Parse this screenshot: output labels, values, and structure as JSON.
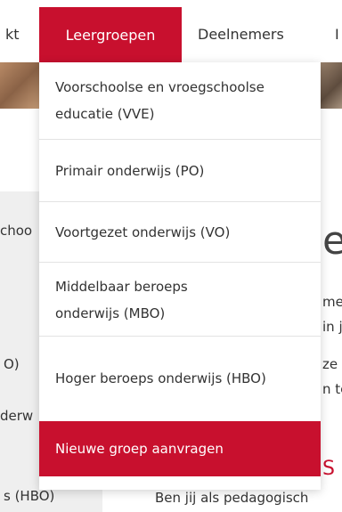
{
  "nav": {
    "left_partial": "kt",
    "active": "Leergroepen",
    "next": "Deelnemers",
    "right_partial": "I"
  },
  "dropdown": {
    "items": [
      "Voorschoolse en vroegschoolse educatie (VVE)",
      "Primair onderwijs (PO)",
      "Voortgezet onderwijs (VO)",
      "Middelbaar beroeps onderwijs (MBO)",
      "Hoger beroeps onderwijs (HBO)"
    ],
    "cta": "Nieuwe groep aanvragen"
  },
  "sidebar": {
    "items": [
      "choo",
      "O)",
      "derw",
      "s (HBO)"
    ]
  },
  "main": {
    "heading_partial": "e",
    "lines": [
      "me",
      "in j",
      "ze",
      "n te"
    ],
    "red_partial": "S",
    "bottom_text": "Ben jij als pedagogisch"
  },
  "colors": {
    "accent": "#c8102e"
  }
}
